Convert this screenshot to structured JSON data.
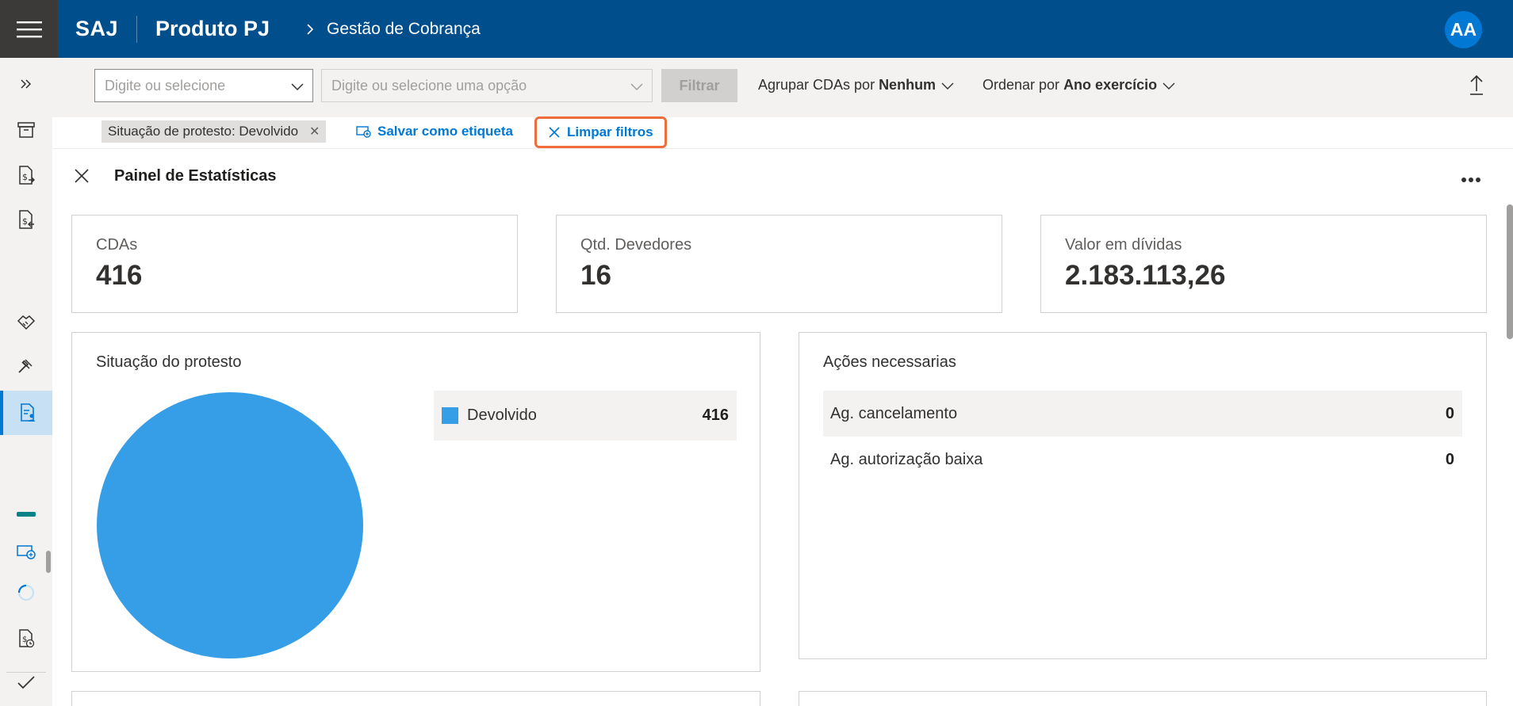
{
  "header": {
    "brand": "SAJ",
    "product": "Produto PJ",
    "breadcrumb": "Gestão de Cobrança",
    "avatar_initials": "AA",
    "bar_color": "#004e8c"
  },
  "rail": {
    "icons": [
      "expand-icon",
      "archive-icon",
      "document-money-send-icon",
      "document-money-receive-icon",
      "handshake-icon",
      "gavel-icon",
      "document-person-icon",
      "minus-bar-icon",
      "add-tag-icon",
      "loading-spinner-icon",
      "document-money-clock-icon",
      "checkmark-icon"
    ],
    "active_item": "document-person-icon"
  },
  "filters": {
    "select1_placeholder": "Digite ou selecione",
    "select2_placeholder": "Digite ou selecione uma opção",
    "filter_button": "Filtrar",
    "group_by_label": "Agrupar CDAs por",
    "group_by_value": "Nenhum",
    "order_by_label": "Ordenar por",
    "order_by_value": "Ano exercício"
  },
  "tags": {
    "active_filter": "Situação de protesto: Devolvido",
    "save_label": "Salvar como etiqueta",
    "clear_label": "Limpar filtros",
    "highlight_color": "#ef6c3b"
  },
  "panel": {
    "title": "Painel de Estatísticas",
    "kpis": [
      {
        "label": "CDAs",
        "value": "416"
      },
      {
        "label": "Qtd. Devedores",
        "value": "16"
      },
      {
        "label": "Valor em dívidas",
        "value": "2.183.113,26"
      }
    ],
    "protest": {
      "title": "Situação do protesto",
      "legend": [
        {
          "label": "Devolvido",
          "value": "416",
          "color": "#359ee6"
        }
      ]
    },
    "actions": {
      "title": "Ações necessarias",
      "items": [
        {
          "label": "Ag. cancelamento",
          "value": "0"
        },
        {
          "label": "Ag. autorização baixa",
          "value": "0"
        }
      ]
    }
  },
  "chart_data": {
    "type": "pie",
    "title": "Situação do protesto",
    "series": [
      {
        "name": "Devolvido",
        "values": [
          416
        ]
      }
    ],
    "categories": [
      "Devolvido"
    ],
    "colors": [
      "#359ee6"
    ]
  }
}
